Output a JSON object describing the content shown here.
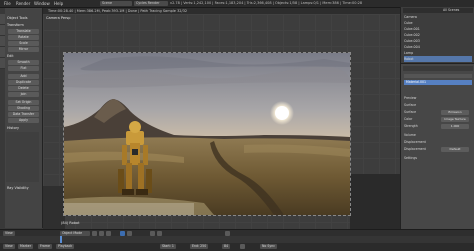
{
  "topbar": {
    "menu": [
      "File",
      "Render",
      "Window",
      "Help"
    ],
    "scene": "Scene",
    "engine": "Cycles Render",
    "status": "v2.78 | Verts:1,242,100 | Faces:1,183,204 | Tris:2,366,408 | Objects:1/58 | Lamps:0/1 | Mem:386 | Time:00:28"
  },
  "viewport_header": {
    "info": "Time:00:28.40 | Mem:386.2M, Peak:393.1M | Done | Path Tracing Sample 32/32"
  },
  "toolshelf": {
    "sections": [
      "Object Tools",
      "Transform",
      "Edit",
      "History"
    ],
    "buttons": [
      "Translate",
      "Rotate",
      "Scale",
      "Mirror",
      "Smooth",
      "Flat",
      "Add",
      "Duplicate",
      "Delete",
      "Join",
      "Set Origin",
      "Shading",
      "Data Transfer",
      "Apply"
    ],
    "bottom_label": "Ray Visibility"
  },
  "viewport": {
    "camera_label": "Camera Persp",
    "object_label": "(84) Robot"
  },
  "outliner": {
    "view": "All Scenes",
    "rows": [
      "Camera",
      "Cube",
      "Cube.001",
      "Cube.002",
      "Cube.003",
      "Cube.004",
      "Lamp",
      "Robot"
    ]
  },
  "properties": {
    "material": "Material.001",
    "rows": [
      {
        "label": "Preview"
      },
      {
        "label": "Surface"
      },
      {
        "label": "Surface",
        "value": "Emission"
      },
      {
        "label": "Color",
        "value": "Image Texture"
      },
      {
        "label": "Strength",
        "value": "1.000"
      },
      {
        "label": "Volume"
      },
      {
        "label": "Displacement"
      },
      {
        "label": "Displacement",
        "value": "Default"
      },
      {
        "label": "Settings"
      }
    ]
  },
  "timeline": {
    "buttons": [
      "View",
      "Marker",
      "Frame",
      "Playback"
    ],
    "start": "Start: 1",
    "end": "End: 250",
    "frame": "84",
    "mode": "Object Mode",
    "sync": "No Sync"
  }
}
